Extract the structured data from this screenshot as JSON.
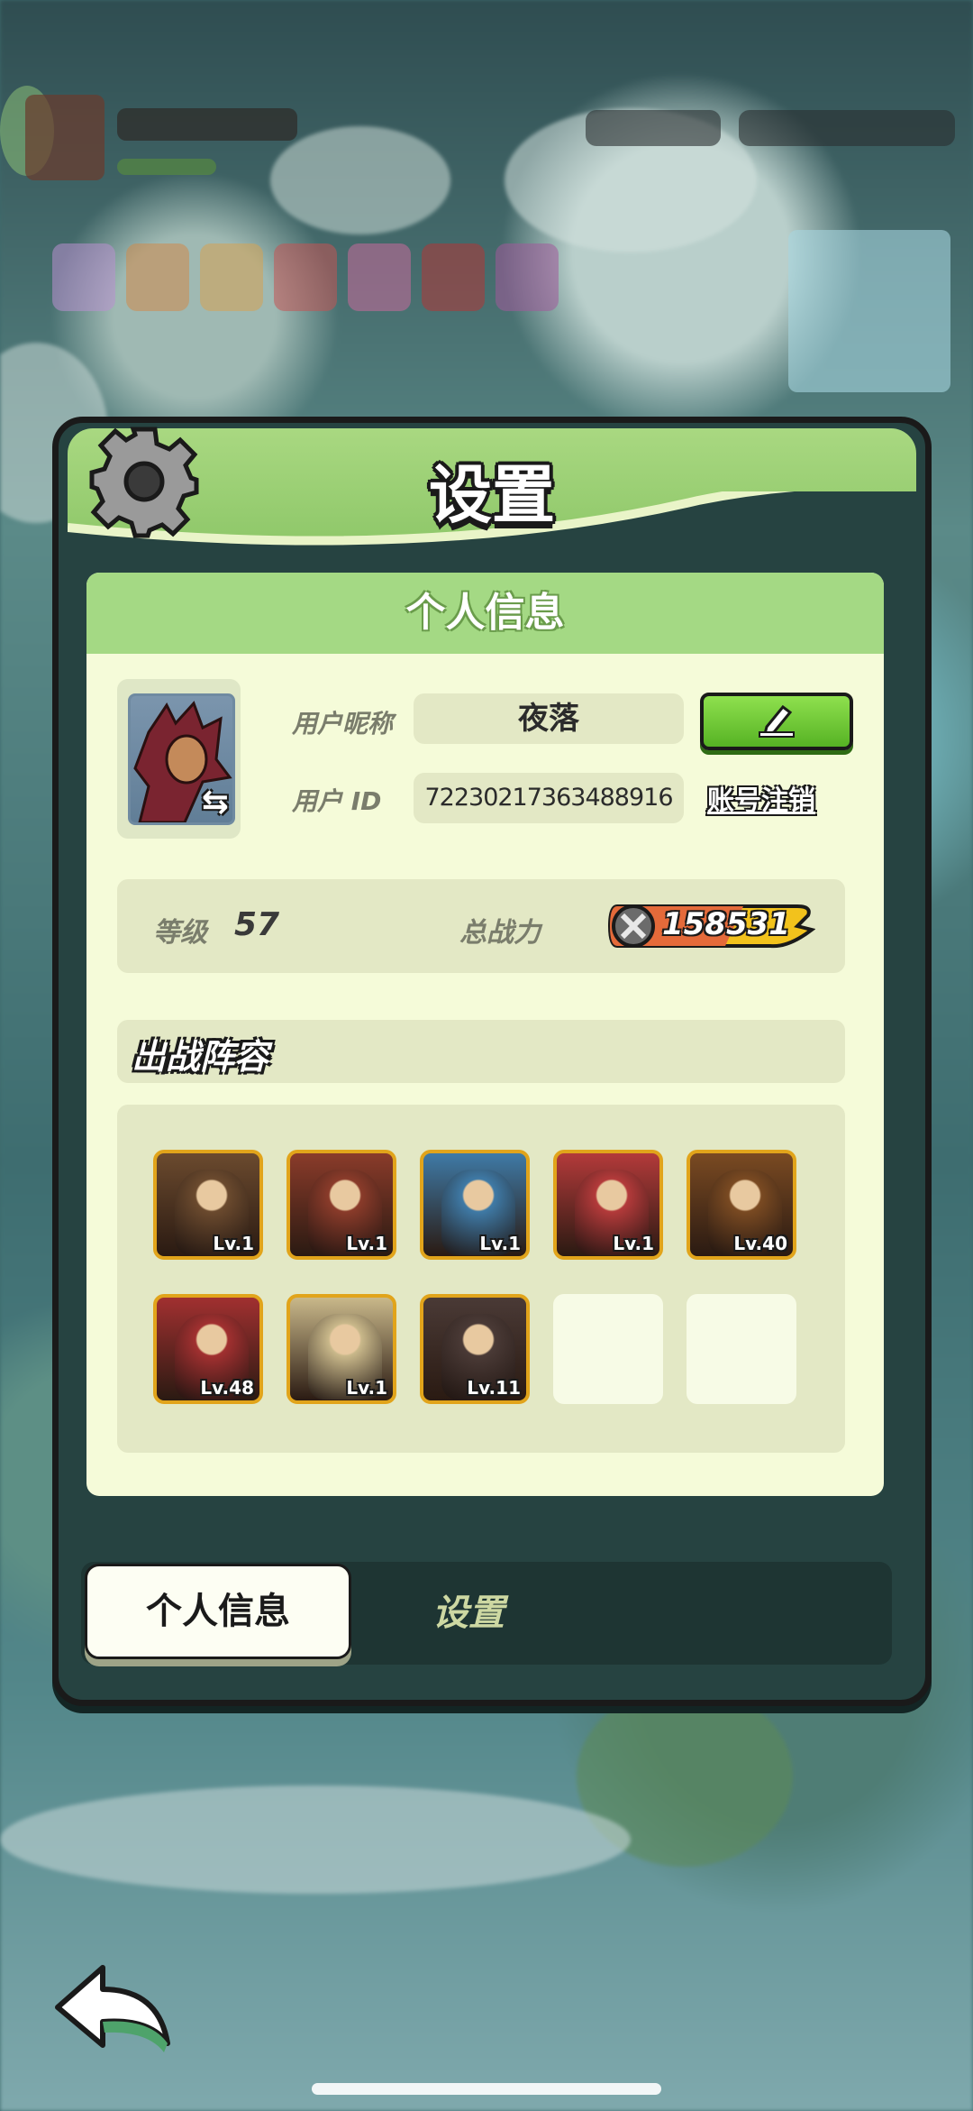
{
  "dialog": {
    "title": "设置"
  },
  "profile": {
    "section_title": "个人信息",
    "nickname_label": "用户昵称",
    "nickname_value": "夜落",
    "id_label": "用户  ID",
    "id_value": "72230217363488916",
    "cancel_account_label": "账号注销"
  },
  "stats": {
    "level_label": "等级",
    "level_value": "57",
    "power_label": "总战力",
    "power_value": "158531"
  },
  "lineup": {
    "title": "出战阵容",
    "heroes": [
      {
        "level": "Lv.1",
        "color": "#6b4a2e"
      },
      {
        "level": "Lv.1",
        "color": "#8a3b2a"
      },
      {
        "level": "Lv.1",
        "color": "#3f7aa6"
      },
      {
        "level": "Lv.1",
        "color": "#b33a3a"
      },
      {
        "level": "Lv.40",
        "color": "#7a4a22"
      },
      {
        "level": "Lv.48",
        "color": "#a13030"
      },
      {
        "level": "Lv.1",
        "color": "#c9b88a"
      },
      {
        "level": "Lv.11",
        "color": "#4a3a36"
      },
      {
        "level": "",
        "color": ""
      },
      {
        "level": "",
        "color": ""
      }
    ]
  },
  "tabs": {
    "personal_info": "个人信息",
    "settings": "设置"
  },
  "colors": {
    "panel": "#f5fbd9",
    "header_green": "#a4d984",
    "accent_orange": "#e1a41b",
    "button_green": "#56b324"
  }
}
